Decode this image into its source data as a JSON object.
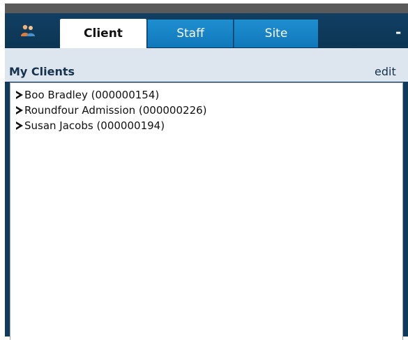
{
  "tabs": [
    {
      "label": "Client",
      "active": true
    },
    {
      "label": "Staff",
      "active": false
    },
    {
      "label": "Site",
      "active": false
    }
  ],
  "header": {
    "minimize_label": "-"
  },
  "section": {
    "title": "My Clients",
    "edit_label": "edit"
  },
  "clients": [
    {
      "label": "Boo Bradley (000000154)"
    },
    {
      "label": "Roundfour Admission (000000226)"
    },
    {
      "label": "Susan Jacobs (000000194)"
    }
  ],
  "colors": {
    "tabbar": "#113f63",
    "inactive_tab": "#1f8fd0",
    "section_header_bg": "#dde6ee"
  },
  "icons": {
    "tab_icon": "people-icon",
    "item_marker": "chevron-right-icon"
  }
}
